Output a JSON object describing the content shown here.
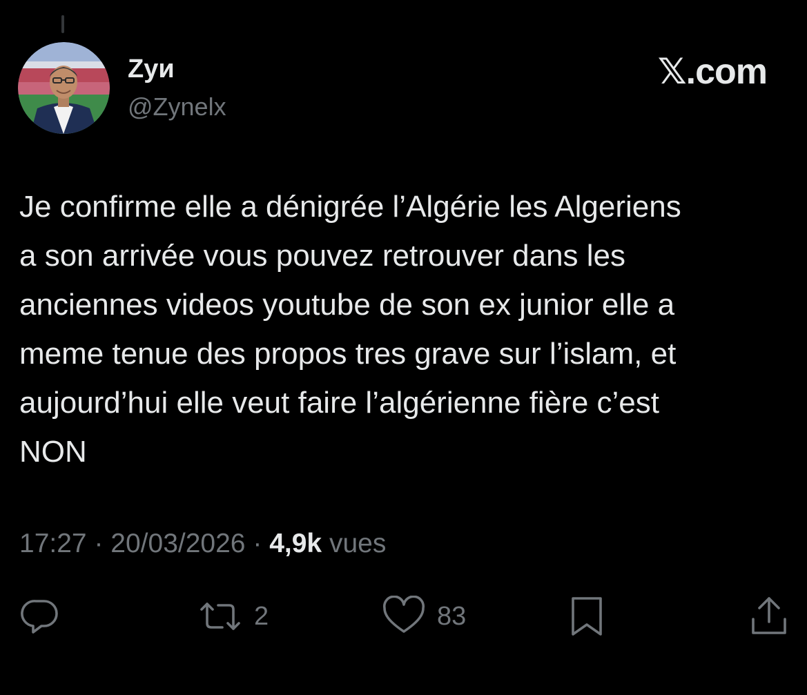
{
  "author": {
    "name": "Zyи",
    "handle": "@Zynelx"
  },
  "brand": "𝕏.com",
  "tweet": {
    "text": "Je confirme elle a dénigrée l’Algérie les Algeriens\na son arrivée vous pouvez retrouver dans les\nanciennes videos youtube de son ex junior elle a\nmeme tenue des propos tres grave sur l’islam, et\naujourd’hui elle veut faire l’algérienne fière c’est\nNON"
  },
  "meta": {
    "time": "17:27",
    "date": "20/03/2026",
    "views_count": "4,9k",
    "views_label": "vues",
    "separator": "·"
  },
  "actions": {
    "reply": {
      "icon": "reply-icon"
    },
    "repost": {
      "icon": "repost-icon",
      "count": "2"
    },
    "like": {
      "icon": "heart-icon",
      "count": "83"
    },
    "bookmark": {
      "icon": "bookmark-icon"
    },
    "share": {
      "icon": "share-icon"
    }
  },
  "colors": {
    "background": "#000000",
    "text_primary": "#e7e9ea",
    "text_secondary": "#71767b"
  }
}
